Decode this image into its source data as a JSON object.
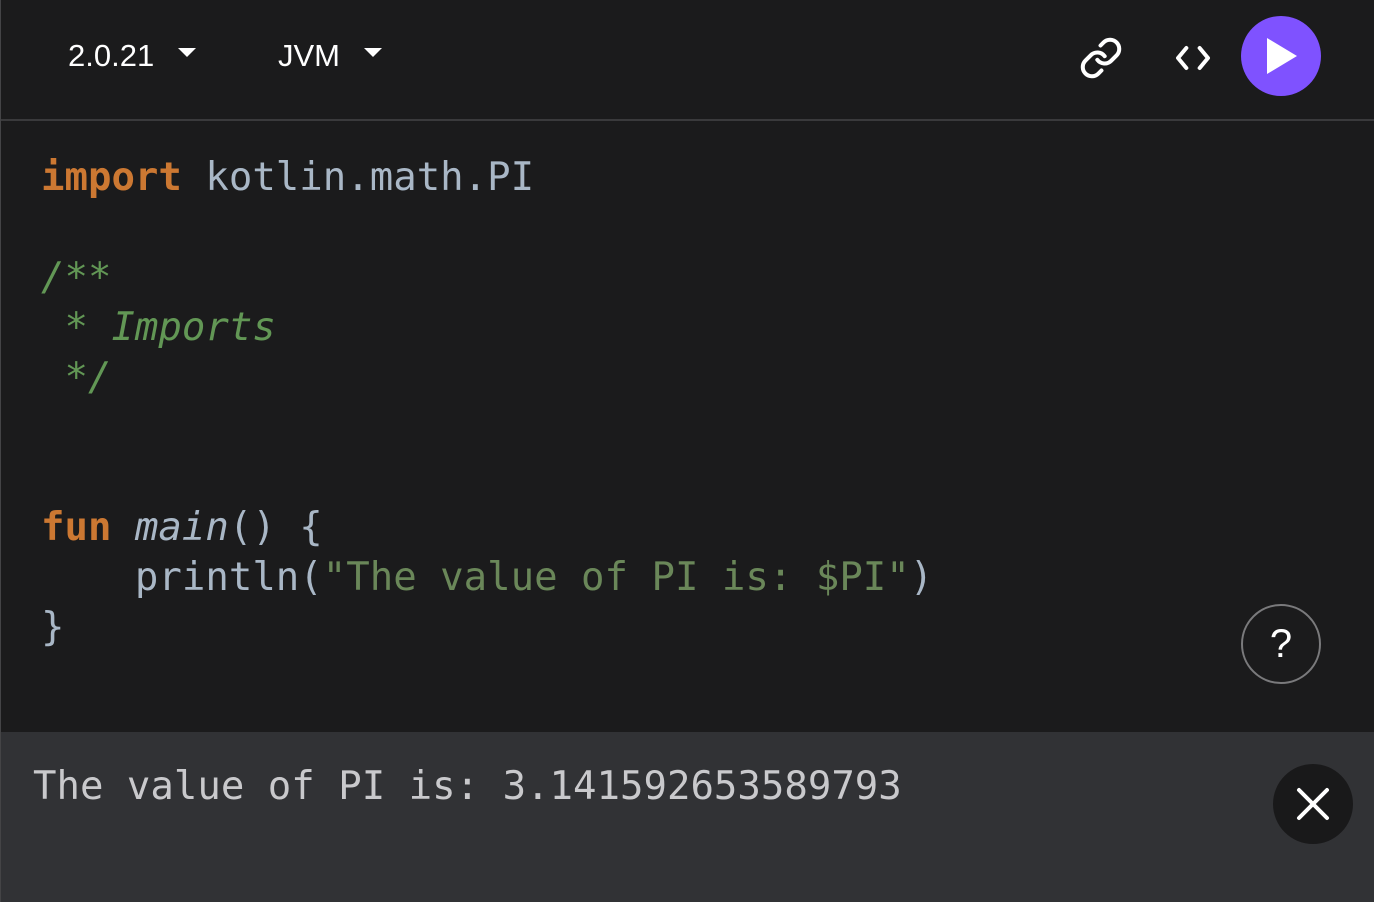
{
  "toolbar": {
    "version": "2.0.21",
    "target": "JVM",
    "icons": {
      "link": "link-icon",
      "embed": "code-brackets-icon",
      "run": "play-icon"
    },
    "run_color": "#7f52ff"
  },
  "editor": {
    "lines": [
      [
        {
          "t": "kw",
          "v": "import"
        },
        {
          "t": "plain",
          "v": " kotlin.math.PI"
        }
      ],
      [],
      [
        {
          "t": "cm",
          "v": "/**"
        }
      ],
      [
        {
          "t": "cm",
          "v": " * Imports"
        }
      ],
      [
        {
          "t": "cm",
          "v": " */"
        }
      ],
      [],
      [],
      [
        {
          "t": "kw",
          "v": "fun"
        },
        {
          "t": "plain",
          "v": " "
        },
        {
          "t": "fn",
          "v": "main"
        },
        {
          "t": "plain",
          "v": "() {"
        }
      ],
      [
        {
          "t": "plain",
          "v": "    println("
        },
        {
          "t": "str",
          "v": "\"The value of PI is: $PI\""
        },
        {
          "t": "plain",
          "v": ")"
        }
      ],
      [
        {
          "t": "plain",
          "v": "}"
        }
      ]
    ],
    "syntax_colors": {
      "keyword": "#cc7832",
      "comment": "#629755",
      "string": "#6a8759",
      "plain": "#a9b7c6"
    }
  },
  "help": {
    "label": "?"
  },
  "output": {
    "text": "The value of PI is: 3.141592653589793",
    "close_icon": "close-icon"
  }
}
